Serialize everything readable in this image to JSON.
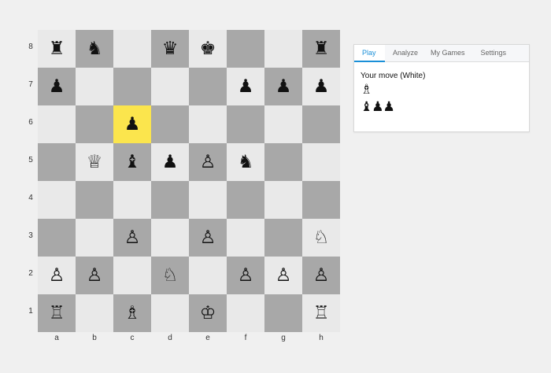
{
  "board": {
    "ranks": [
      "8",
      "7",
      "6",
      "5",
      "4",
      "3",
      "2",
      "1"
    ],
    "files": [
      "a",
      "b",
      "c",
      "d",
      "e",
      "f",
      "g",
      "h"
    ],
    "squares": [
      [
        "♜",
        "♞",
        "",
        "♛",
        "♚",
        "",
        "",
        "♜"
      ],
      [
        "♟",
        "",
        "",
        "",
        "",
        "♟",
        "♟",
        "♟"
      ],
      [
        "",
        "",
        "♟",
        "",
        "",
        "",
        "",
        ""
      ],
      [
        "",
        "♕",
        "♝",
        "♟",
        "♙",
        "♞",
        "",
        ""
      ],
      [
        "",
        "",
        "",
        "",
        "",
        "",
        "",
        ""
      ],
      [
        "",
        "",
        "♙",
        "",
        "♙",
        "",
        "",
        "♘"
      ],
      [
        "♙",
        "♙",
        "",
        "♘",
        "",
        "♙",
        "♙",
        "♙"
      ],
      [
        "♖",
        "",
        "♗",
        "",
        "♔",
        "",
        "",
        "♖"
      ]
    ],
    "highlight": "c6",
    "colors": {
      "light": "#e9e9e9",
      "dark": "#a8a8a8",
      "highlight": "#fbe54d"
    }
  },
  "panel": {
    "tabs": [
      "Play",
      "Analyze",
      "My Games",
      "Settings"
    ],
    "active_tab": "Play",
    "accent": "#1a8fd8",
    "status": "Your move (White)",
    "captured_by_black": [
      "♗"
    ],
    "captured_by_white": [
      "♝",
      "♟",
      "♟"
    ]
  }
}
